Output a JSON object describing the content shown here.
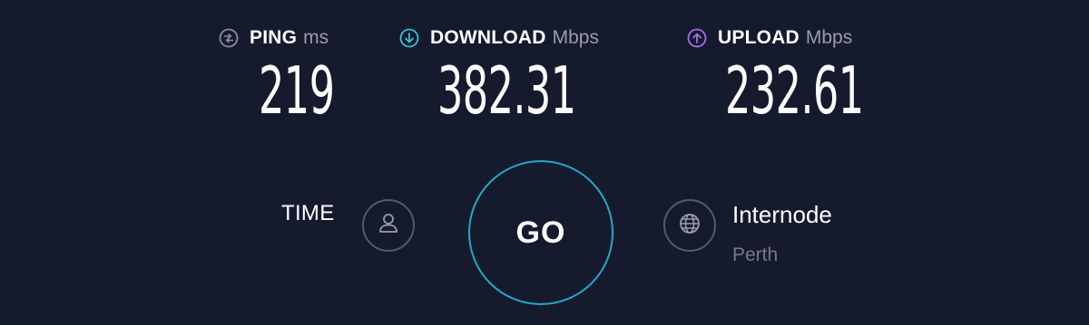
{
  "metrics": {
    "ping": {
      "label": "PING",
      "unit": "ms",
      "value": "219",
      "icon": "ping-icon",
      "icon_color": "#8a8c98"
    },
    "download": {
      "label": "DOWNLOAD",
      "unit": "Mbps",
      "value": "382.31",
      "icon": "download-arrow-icon",
      "icon_color": "#2ec4d8"
    },
    "upload": {
      "label": "UPLOAD",
      "unit": "Mbps",
      "value": "232.61",
      "icon": "upload-arrow-icon",
      "icon_color": "#a46cf0"
    }
  },
  "connection": {
    "time_label": "TIME",
    "go_label": "GO",
    "provider_name": "Internode",
    "provider_location": "Perth"
  },
  "colors": {
    "background": "#161a2d",
    "go_ring": "#23a7c8",
    "muted_text": "#75798a"
  }
}
